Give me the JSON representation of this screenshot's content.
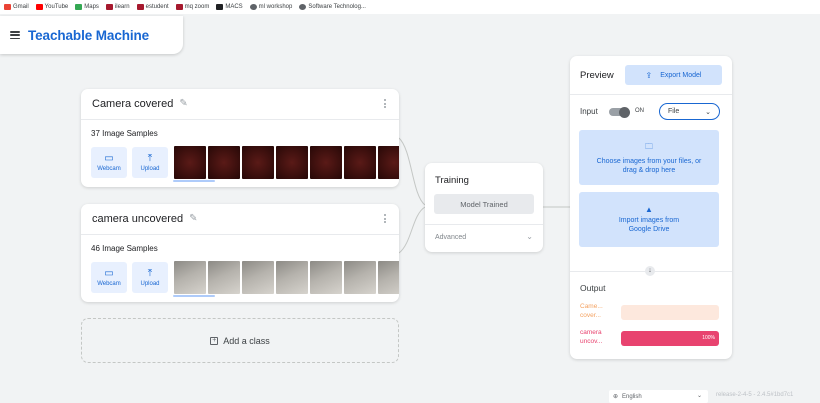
{
  "bookmarks": [
    {
      "label": "Gmail",
      "color": "#ea4335"
    },
    {
      "label": "YouTube",
      "color": "#ff0000"
    },
    {
      "label": "Maps",
      "color": "#34a853"
    },
    {
      "label": "ilearn",
      "color": "#a6192e"
    },
    {
      "label": "estudent",
      "color": "#a6192e"
    },
    {
      "label": "mq zoom",
      "color": "#a6192e"
    },
    {
      "label": "MACS",
      "color": "#202124"
    },
    {
      "label": "ml workshop",
      "color": "#5f6368"
    },
    {
      "label": "Software Technolog...",
      "color": "#5f6368"
    }
  ],
  "header": {
    "title": "Teachable Machine"
  },
  "classes": [
    {
      "name": "Camera covered",
      "samples": "37 Image Samples",
      "webcam": "Webcam",
      "upload": "Upload"
    },
    {
      "name": "camera uncovered",
      "samples": "46 Image Samples",
      "webcam": "Webcam",
      "upload": "Upload"
    }
  ],
  "add_class": "Add a class",
  "training": {
    "title": "Training",
    "button": "Model Trained",
    "advanced": "Advanced"
  },
  "preview": {
    "title": "Preview",
    "export": "Export Model",
    "input_label": "Input",
    "toggle_state": "ON",
    "source": "File",
    "drop_text": "Choose images from your files, or drag & drop here",
    "drive_text": "Import images from Google Drive",
    "output_label": "Output",
    "outputs": [
      {
        "name": "Came... cover...",
        "percent": 0,
        "color": "#f4a261",
        "track": "#fde8dd",
        "label": ""
      },
      {
        "name": "camera uncov...",
        "percent": 100,
        "color": "#e8436f",
        "track": "#fce4ec",
        "label": "100%"
      }
    ]
  },
  "footer": {
    "language": "English",
    "release": "release-2-4-5 - 2.4.5#1bd7c1"
  }
}
